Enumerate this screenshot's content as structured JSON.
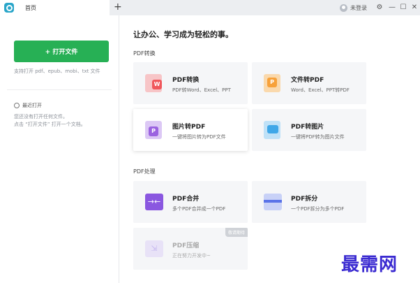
{
  "tabs": [
    {
      "label": "首页"
    }
  ],
  "titlebar": {
    "user_label": "未登录",
    "add_tab": "+",
    "settings_icon": "⚙",
    "minimize": "—",
    "maximize": "☐",
    "close": "✕"
  },
  "sidebar": {
    "open_button": "+ 打开文件",
    "support_text": "支持打开 pdf、epub、mobi、txt 文件",
    "recent_title": "最近打开",
    "recent_lines": [
      "您还没有打开任何文件。",
      "点击 “打开文件” 打开一个文档。"
    ]
  },
  "main": {
    "title": "让办公、学习成为轻松的事。",
    "sections": [
      {
        "label": "PDF转换",
        "cards": [
          {
            "title": "PDF转换",
            "desc": "PDF转Word、Excel、PPT",
            "icon": "pdf-to-word-icon",
            "color": "#f0575c"
          },
          {
            "title": "文件转PDF",
            "desc": "Word、Excel、PPT转PDF",
            "icon": "file-to-pdf-icon",
            "color": "#f7a13a"
          },
          {
            "title": "图片转PDF",
            "desc": "一键将图片转为PDF文件",
            "icon": "image-to-pdf-icon",
            "color": "#9b63e0"
          },
          {
            "title": "PDF转图片",
            "desc": "一键将PDF转为图片文件",
            "icon": "pdf-to-image-icon",
            "color": "#3fa7e8"
          }
        ]
      },
      {
        "label": "PDF处理",
        "cards": [
          {
            "title": "PDF合并",
            "desc": "多个PDF合并成一个PDF",
            "icon": "pdf-merge-icon",
            "color": "#8a57e0"
          },
          {
            "title": "PDF拆分",
            "desc": "一个PDF拆分为多个PDF",
            "icon": "pdf-split-icon",
            "color": "#5a73e8"
          },
          {
            "title": "PDF压缩",
            "desc": "正在努力开发中~",
            "icon": "pdf-compress-icon",
            "color": "#d6cdef",
            "badge": "敬请期待"
          }
        ]
      }
    ]
  },
  "watermark": "最需网"
}
